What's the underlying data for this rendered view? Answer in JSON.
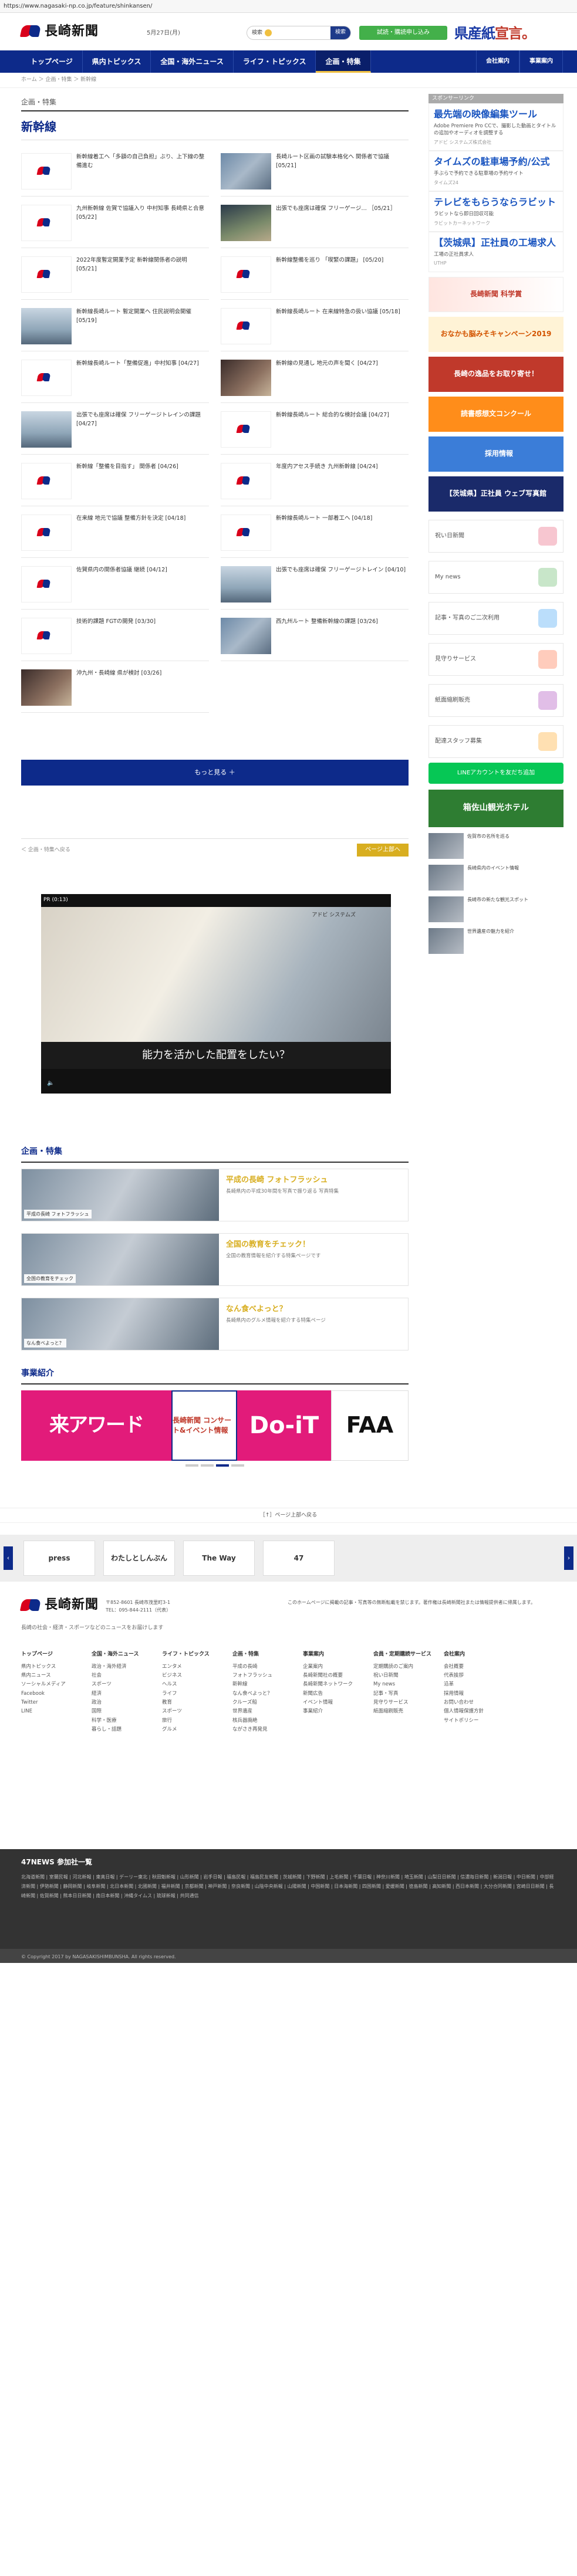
{
  "browser": {
    "url": "https://www.nagasaki-np.co.jp/feature/shinkansen/"
  },
  "header": {
    "logo_text": "長崎新聞",
    "date": "5月27日(月)",
    "search_placeholder": "検索",
    "search_button": "検索",
    "trial_button": "試読・購読申し込み",
    "promo_text": "県産紙",
    "promo_suffix": "宣言。"
  },
  "nav": {
    "items": [
      {
        "label": "トップページ"
      },
      {
        "label": "県内トピックス"
      },
      {
        "label": "全国・海外ニュース"
      },
      {
        "label": "ライフ・トピックス"
      },
      {
        "label": "企画・特集"
      }
    ],
    "right": [
      {
        "label": "会社案内"
      },
      {
        "label": "事業案内"
      }
    ]
  },
  "breadcrumb": "ホーム ＞ 企画・特集 ＞ 新幹線",
  "section_label": "企画・特集",
  "page_title": "新幹線",
  "articles": [
    {
      "text": "新幹線着工へ「多額の自己負担」ぶり、上下線の整備進む",
      "date": "[05/22]",
      "thumb": "logo"
    },
    {
      "text": "長崎ルート区画の試験本格化へ 関係者で協議 [05/21]",
      "date": "",
      "thumb": "photo"
    },
    {
      "text": "九州新幹線 佐賀で協議入り 中村知事 長崎県と合意 [05/22]",
      "date": "",
      "thumb": "logo"
    },
    {
      "text": "出張でも座席は確保 フリーゲージ… ［05/21］",
      "date": "",
      "thumb": "photo2"
    },
    {
      "text": "2022年度暫定開業予定 新幹線関係者の説明 [05/21]",
      "date": "",
      "thumb": "logo"
    },
    {
      "text": "新幹線整備を巡り 「喫緊の課題」 [05/20]",
      "date": "",
      "thumb": "logo"
    },
    {
      "text": "新幹線長崎ルート 暫定開業へ 住民説明会開催 [05/19]",
      "date": "",
      "thumb": "photo3"
    },
    {
      "text": "新幹線長崎ルート 在来線特急の扱い協議 [05/18]",
      "date": "",
      "thumb": "logo"
    },
    {
      "text": "新幹線長崎ルート「整備促進」中村知事 [04/27]",
      "date": "",
      "thumb": "logo"
    },
    {
      "text": "新幹線の見通し 地元の声を聞く [04/27]",
      "date": "",
      "thumb": "dark"
    },
    {
      "text": "出張でも座席は確保 フリーゲージトレインの課題 [04/27]",
      "date": "",
      "thumb": "photo3"
    },
    {
      "text": "新幹線長崎ルート 総合的な検討会議 [04/27]",
      "date": "",
      "thumb": "logo"
    },
    {
      "text": "新幹線「整備を目指す」 関係者 [04/26]",
      "date": "",
      "thumb": "logo"
    },
    {
      "text": "年度内アセス手続き 九州新幹線 [04/24]",
      "date": "",
      "thumb": "logo"
    },
    {
      "text": "在来線 地元で協議 整備方針を決定 [04/18]",
      "date": "",
      "thumb": "logo"
    },
    {
      "text": "新幹線長崎ルート 一部着工へ [04/18]",
      "date": "",
      "thumb": "logo"
    },
    {
      "text": "佐賀県内の関係者協議 継続 [04/12]",
      "date": "",
      "thumb": "logo"
    },
    {
      "text": "出張でも座席は確保 フリーゲージトレイン [04/10]",
      "date": "",
      "thumb": "photo3"
    },
    {
      "text": "技術的課題 FGTの開発 [03/30]",
      "date": "",
      "thumb": "logo"
    },
    {
      "text": "西九州ルート 整備新幹線の課題 [03/26]",
      "date": "",
      "thumb": "photo"
    },
    {
      "text": "沖九州・長崎線 県が検討 [03/26]",
      "date": "",
      "thumb": "dark"
    }
  ],
  "more_button": "もっと見る ＋",
  "pager": {
    "back": "＜ 企画・特集へ戻る",
    "top": "ページ上部へ"
  },
  "video": {
    "pr": "PR (0:13)",
    "brand": "アドビ システムズ",
    "caption": "能力を活かした配置をしたい？"
  },
  "features_title": "企画・特集",
  "features": [
    {
      "title": "平成の長崎 フォトフラッシュ",
      "desc": "長崎県内の平成30年間を写真で振り返る 写真特集",
      "chip": "平成の長崎 フォトフラッシュ"
    },
    {
      "title": "全国の教育をチェック！",
      "desc": "全国の教育情報を紹介する特集ページです",
      "chip": "全国の教育をチェック"
    },
    {
      "title": "なん食べよっと？",
      "desc": "長崎県内のグルメ情報を紹介する特集ページ",
      "chip": "なん食べよっと？"
    }
  ],
  "business_title": "事業紹介",
  "banners": [
    {
      "label": "来アワード"
    },
    {
      "label": "長崎新聞 コンサート&イベント情報"
    },
    {
      "label": "Do-iT"
    },
    {
      "label": "FAA"
    }
  ],
  "sidebar": {
    "ad_label": "スポンサーリンク",
    "sponsored": [
      {
        "title": "最先端の映像編集ツール",
        "desc": "Adobe Premiere Pro CCで、撮影した動画とタイトルの追加やオーディオを調整する",
        "src": "アドビ システムズ株式会社"
      },
      {
        "title": "タイムズの駐車場予約/公式",
        "desc": "手ぶらで予約できる駐車場の予約サイト",
        "src": "タイムズ24"
      },
      {
        "title": "テレビをもらうならラビット",
        "desc": "ラビットなら即日回収可能",
        "src": "ラビットカーネットワーク"
      },
      {
        "title": "【茨城県】正社員の工場求人",
        "desc": "工場の正社員求人",
        "src": "UTHP"
      }
    ],
    "banners": [
      {
        "label": "長崎新聞 科学賞"
      },
      {
        "label": "おなかも脳みそキャンペーン2019"
      },
      {
        "label": "長崎の逸品をお取り寄せ！"
      },
      {
        "label": "読書感想文コンクール"
      },
      {
        "label": "採用情報"
      },
      {
        "label": "【茨城県】正社員 ウェブ写真館"
      }
    ],
    "services": [
      {
        "label": "祝い日新聞"
      },
      {
        "label": "My news"
      },
      {
        "label": "記事・写真のご二次利用"
      },
      {
        "label": "見守りサービス"
      },
      {
        "label": "紙面縮刷販売"
      },
      {
        "label": "配達スタッフ募集"
      }
    ],
    "line_button": "LINEアカウントを友だち追加",
    "hotel_label": "箱佐山観光ホテル",
    "mini_news": [
      {
        "text": "佐賀市の名所を巡る"
      },
      {
        "text": "長崎県内のイベント情報"
      },
      {
        "text": "長崎市の新たな観光スポット"
      },
      {
        "text": "世界遺産の魅力を紹介"
      }
    ]
  },
  "back_top": "［↑］ページ上部へ戻る",
  "carousel": [
    {
      "label": "press"
    },
    {
      "label": "わたしとしんぶん"
    },
    {
      "label": "The Way"
    },
    {
      "label": "47"
    }
  ],
  "footer": {
    "logo_text": "長崎新聞",
    "address": "〒852-8601 長崎市茂里町3-1\nTEL：095-844-2111（代表）",
    "notes": "このホームページに掲載の記事・写真等の無断転載を禁じます。著作権は長崎新聞社または情報提供者に帰属します。",
    "tagline": "長崎の社会・経済・スポーツなどのニュースをお届けします",
    "sitemap": [
      {
        "head": "トップページ",
        "items": [
          "県内トピックス",
          "県内ニュース",
          "ソーシャルメディア",
          "Facebook",
          "Twitter",
          "LINE"
        ]
      },
      {
        "head": "全国・海外ニュース",
        "items": [
          "政治・海外経済",
          "社会",
          "スポーツ",
          "経済",
          "政治",
          "国際",
          "科学・医療",
          "暮らし・話題"
        ]
      },
      {
        "head": "ライフ・トピックス",
        "items": [
          "エンタメ",
          "ビジネス",
          "ヘルス",
          "ライフ",
          "教育",
          "スポーツ",
          "旅行",
          "グルメ"
        ]
      },
      {
        "head": "企画・特集",
        "items": [
          "平成の長崎",
          "フォトフラッシュ",
          "新幹線",
          "なん食べよっと？",
          "クルーズ船",
          "世界遺産",
          "核兵器廃絶",
          "ながさき再発見"
        ]
      },
      {
        "head": "事業案内",
        "items": [
          "企業案内",
          "長崎新聞社の概要",
          "長崎新聞ネットワーク",
          "新聞広告",
          "イベント情報",
          "事業紹介"
        ]
      },
      {
        "head": "会員・定期購読サービス",
        "items": [
          "定期購読のご案内",
          "祝い日新聞",
          "My news",
          "記事・写真",
          "見守りサービス",
          "紙面縮刷販売"
        ]
      },
      {
        "head": "会社案内",
        "items": [
          "会社概要",
          "代表挨拶",
          "沿革",
          "採用情報",
          "お問い合わせ",
          "個人情報保護方針",
          "サイトポリシー"
        ]
      }
    ],
    "network_title": "47NEWS 参加社一覧",
    "network_links": "北海道新聞 | 室蘭民報 | 河北新報 | 東奥日報 | デーリー東北 | 秋田魁新報 | 山形新聞 | 岩手日報 | 福島民報 | 福島民友新聞 | 茨城新聞 | 下野新聞 | 上毛新聞 | 千葉日報 | 神奈川新聞 | 埼玉新聞 | 山梨日日新聞 | 信濃毎日新聞 | 新潟日報 | 中日新聞 | 中部経済新聞 | 伊勢新聞 | 静岡新聞 | 岐阜新聞 | 北日本新聞 | 北國新聞 | 福井新聞 | 京都新聞 | 神戸新聞 | 奈良新聞 | 山陰中央新報 | 山陽新聞 | 中国新聞 | 日本海新聞 | 四国新聞 | 愛媛新聞 | 徳島新聞 | 高知新聞 | 西日本新聞 | 大分合同新聞 | 宮崎日日新聞 | 長崎新聞 | 佐賀新聞 | 熊本日日新聞 | 南日本新聞 | 沖縄タイムス | 琉球新報 | 共同通信",
    "copyright": "© Copyright 2017 by NAGASAKISHIMBUNSHA. All rights reserved."
  }
}
